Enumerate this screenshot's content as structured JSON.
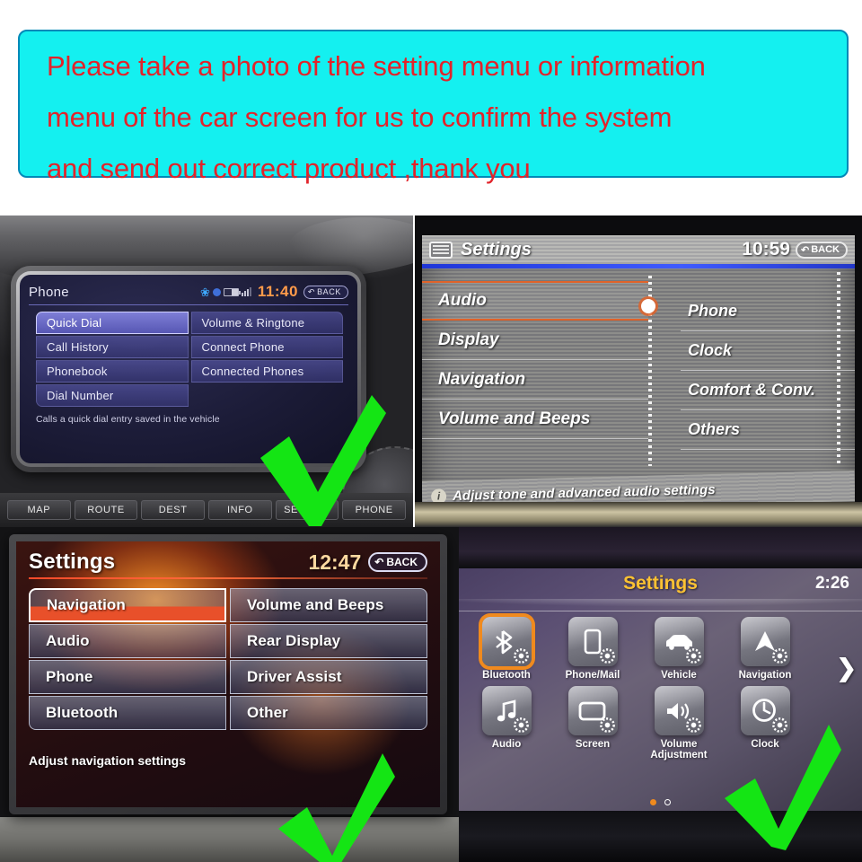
{
  "banner": {
    "lines": [
      "Please take a photo of the setting menu or information",
      "menu of the car screen for us to confirm the system",
      "and send out correct product ,thank you"
    ],
    "background_color": "#14f0f0",
    "text_color": "#e2232a",
    "border_color": "#0089b8"
  },
  "panel_top_left": {
    "screen_title": "Phone",
    "time": "11:40",
    "back_label": "BACK",
    "status_icons": [
      "bluetooth-icon",
      "phone-link-icon",
      "battery-icon",
      "signal-icon"
    ],
    "menu_left": [
      {
        "label": "Quick Dial",
        "selected": true
      },
      {
        "label": "Call History",
        "selected": false
      },
      {
        "label": "Phonebook",
        "selected": false
      },
      {
        "label": "Dial Number",
        "selected": false
      }
    ],
    "menu_right": [
      {
        "label": "Volume & Ringtone",
        "selected": false
      },
      {
        "label": "Connect Phone",
        "selected": false
      },
      {
        "label": "Connected Phones",
        "selected": false
      }
    ],
    "caption": "Calls a quick dial entry saved in the vehicle",
    "hard_buttons": [
      "MAP",
      "ROUTE",
      "DEST",
      "INFO",
      "SETTING",
      "PHONE"
    ]
  },
  "panel_top_right": {
    "screen_title": "Settings",
    "time": "10:59",
    "back_label": "BACK",
    "menu_left": [
      {
        "label": "Audio",
        "selected": true
      },
      {
        "label": "Display",
        "selected": false
      },
      {
        "label": "Navigation",
        "selected": false
      },
      {
        "label": "Volume and Beeps",
        "selected": false
      }
    ],
    "menu_right": [
      {
        "label": "Phone",
        "selected": false
      },
      {
        "label": "Clock",
        "selected": false
      },
      {
        "label": "Comfort & Conv.",
        "selected": false
      },
      {
        "label": "Others",
        "selected": false
      }
    ],
    "caption": "Adjust tone and advanced audio settings",
    "info_glyph": "i",
    "accent_color": "#e0632a"
  },
  "panel_bottom_left": {
    "screen_title": "Settings",
    "time": "12:47",
    "back_label": "BACK",
    "menu_left": [
      {
        "label": "Navigation",
        "selected": true
      },
      {
        "label": "Audio",
        "selected": false
      },
      {
        "label": "Phone",
        "selected": false
      },
      {
        "label": "Bluetooth",
        "selected": false
      }
    ],
    "menu_right": [
      {
        "label": "Volume and Beeps",
        "selected": false
      },
      {
        "label": "Rear Display",
        "selected": false
      },
      {
        "label": "Driver Assist",
        "selected": false
      },
      {
        "label": "Other",
        "selected": false
      }
    ],
    "caption": "Adjust navigation settings",
    "accent_color": "#e8502a"
  },
  "panel_bottom_right": {
    "screen_title": "Settings",
    "time": "2:26",
    "title_color": "#fcc233",
    "selection_color": "#f08a1e",
    "next_arrow": "❯",
    "tiles_row1": [
      {
        "label": "Bluetooth",
        "icon": "bluetooth-gear-icon",
        "selected": true
      },
      {
        "label": "Phone/Mail",
        "icon": "phone-gear-icon",
        "selected": false
      },
      {
        "label": "Vehicle",
        "icon": "car-gear-icon",
        "selected": false
      },
      {
        "label": "Navigation",
        "icon": "navigation-arrow-gear-icon",
        "selected": false
      }
    ],
    "tiles_row2": [
      {
        "label": "Audio",
        "icon": "music-note-gear-icon",
        "selected": false
      },
      {
        "label": "Screen",
        "icon": "screen-gear-icon",
        "selected": false
      },
      {
        "label": "Volume Adjustment",
        "icon": "speaker-gear-icon",
        "selected": false
      },
      {
        "label": "Clock",
        "icon": "clock-gear-icon",
        "selected": false
      }
    ],
    "page_dots": [
      {
        "active": true
      },
      {
        "active": false
      }
    ]
  },
  "checkmarks": {
    "color": "#14e514",
    "count": 4
  }
}
